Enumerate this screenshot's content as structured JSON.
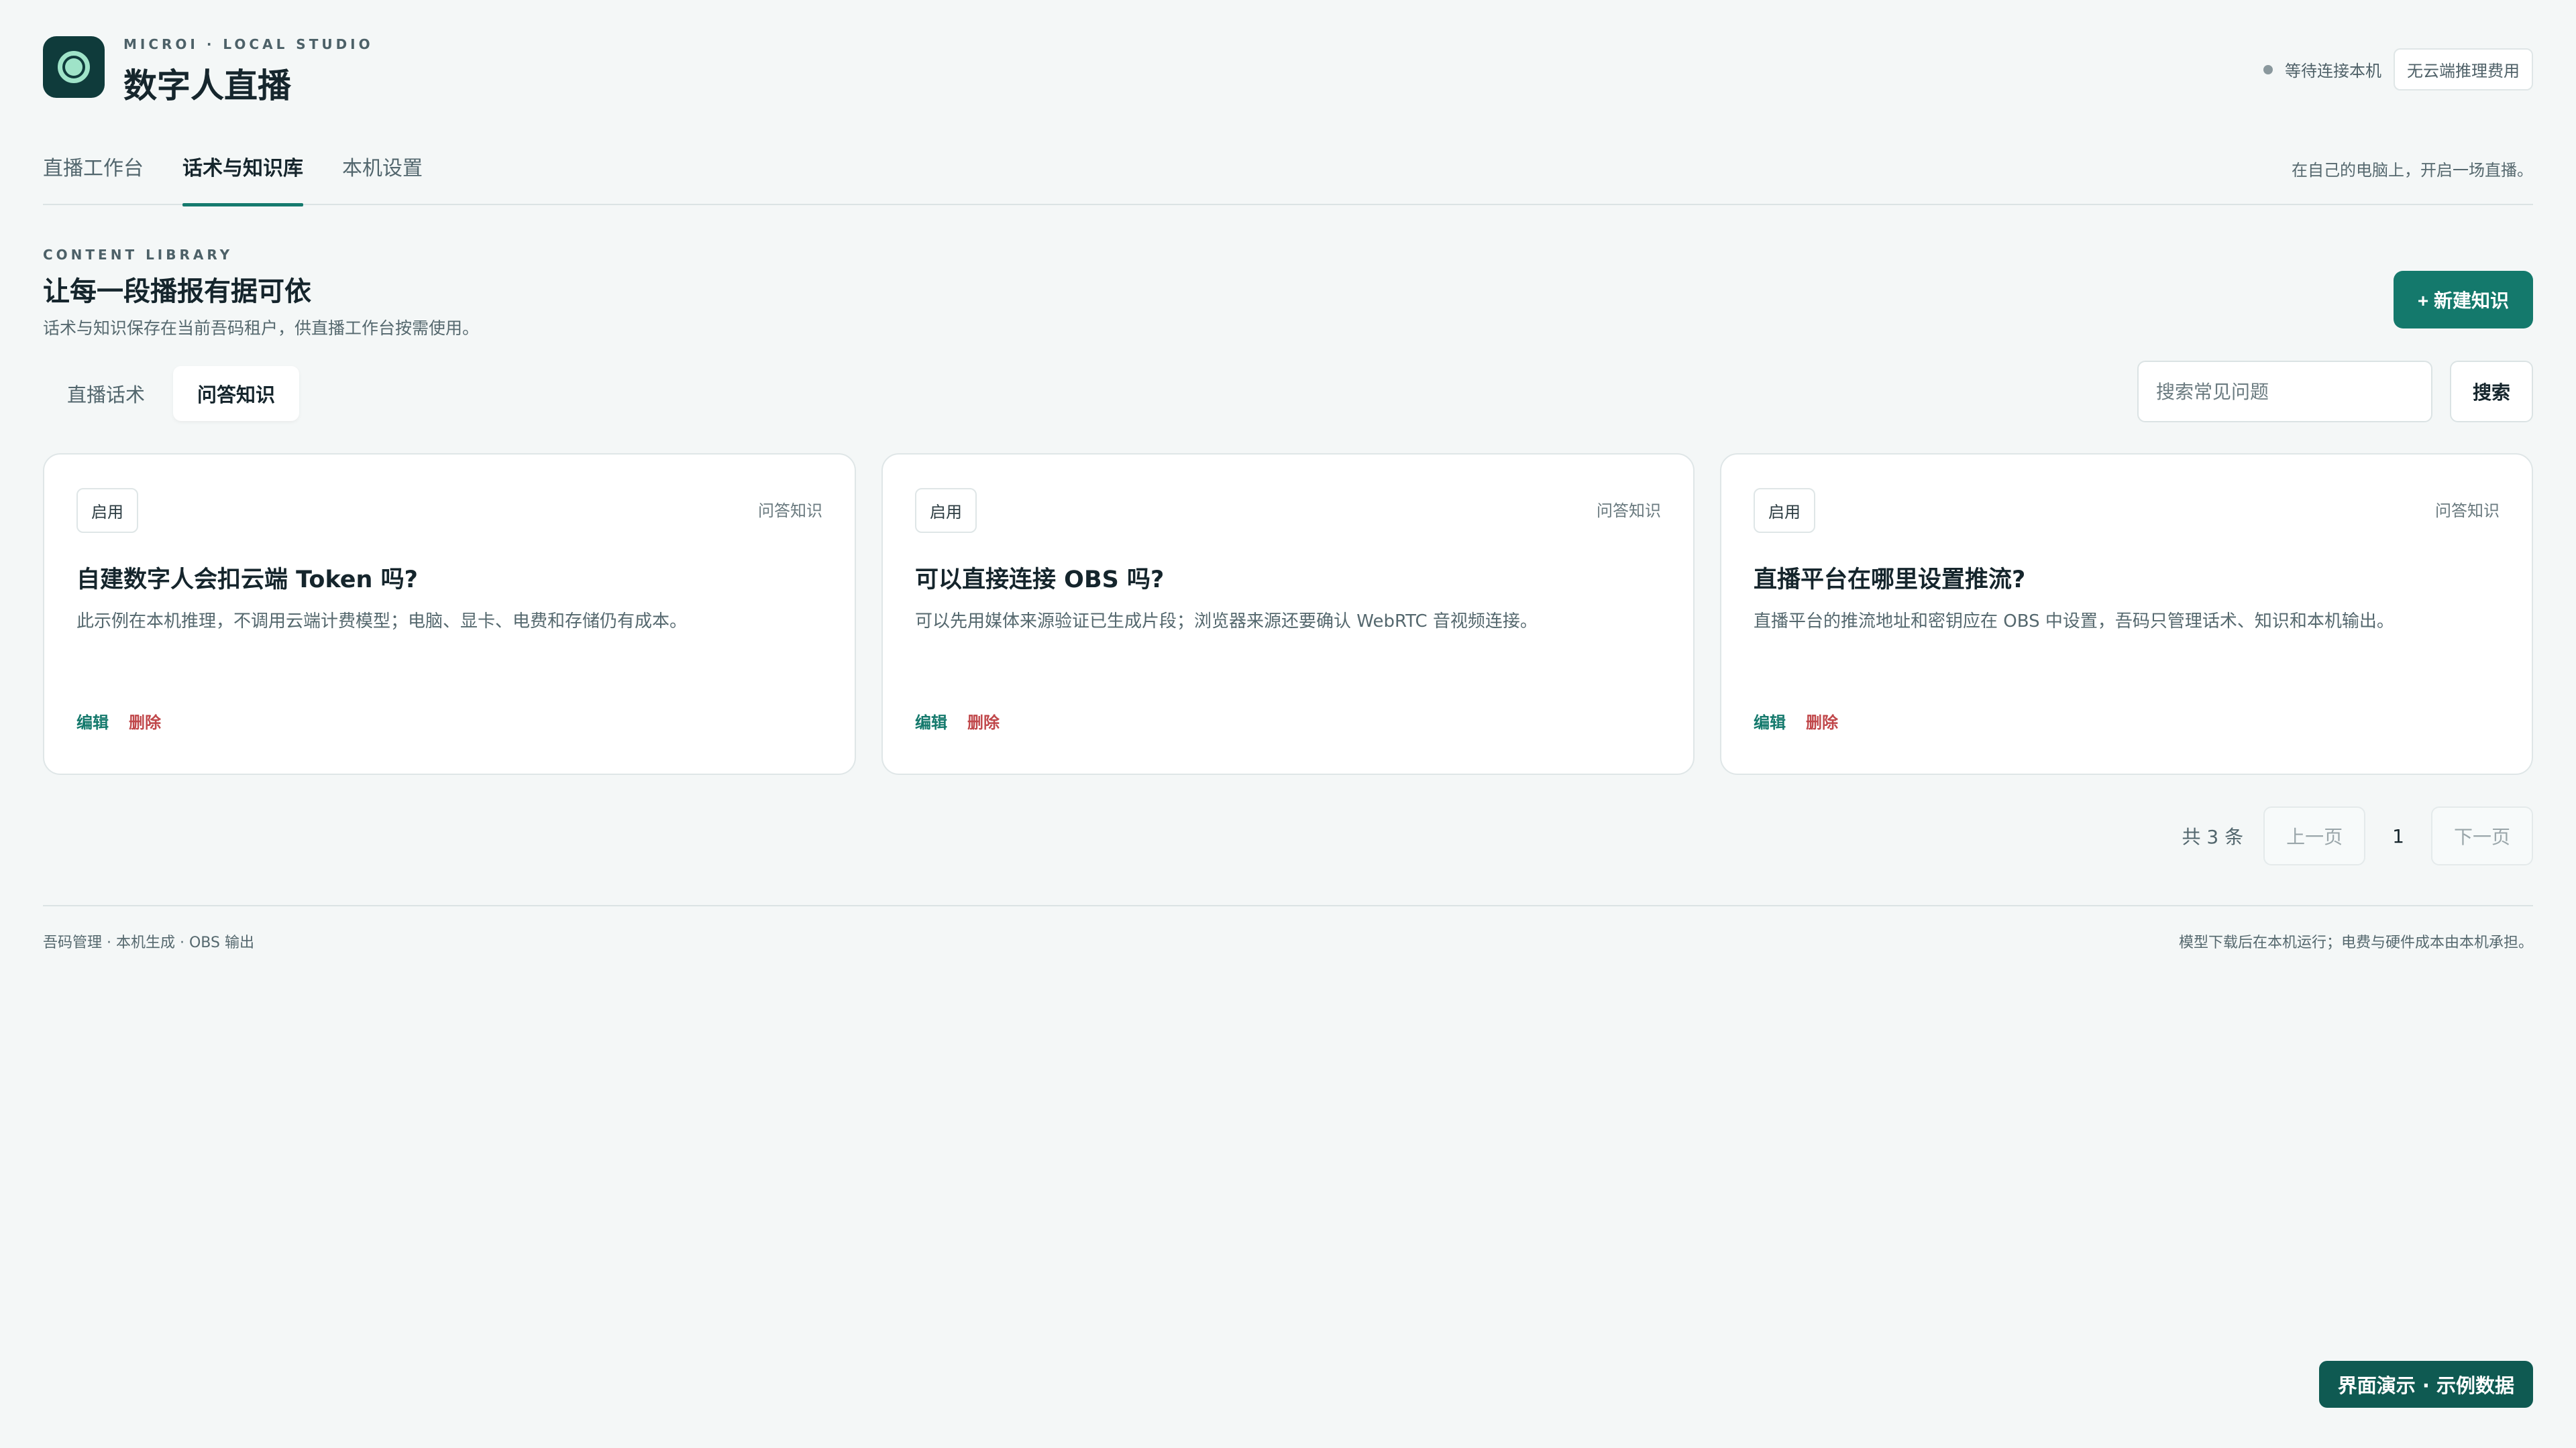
{
  "brand": {
    "small": "MICROI · LOCAL STUDIO",
    "title": "数字人直播"
  },
  "header": {
    "status_text": "等待连接本机",
    "badge": "无云端推理费用"
  },
  "nav": {
    "tabs": [
      {
        "label": "直播工作台"
      },
      {
        "label": "话术与知识库"
      },
      {
        "label": "本机设置"
      }
    ],
    "active_index": 1,
    "tagline": "在自己的电脑上，开启一场直播。"
  },
  "section": {
    "eyebrow": "CONTENT LIBRARY",
    "title": "让每一段播报有据可依",
    "desc": "话术与知识保存在当前吾码租户，供直播工作台按需使用。",
    "new_button": "+ 新建知识"
  },
  "subtabs": [
    {
      "label": "直播话术"
    },
    {
      "label": "问答知识"
    }
  ],
  "search": {
    "placeholder": "搜索常见问题",
    "button": "搜索"
  },
  "cards": [
    {
      "status": "启用",
      "type": "问答知识",
      "title": "自建数字人会扣云端 Token 吗?",
      "desc": "此示例在本机推理，不调用云端计费模型；电脑、显卡、电费和存储仍有成本。",
      "edit": "编辑",
      "delete": "删除"
    },
    {
      "status": "启用",
      "type": "问答知识",
      "title": "可以直接连接 OBS 吗?",
      "desc": "可以先用媒体来源验证已生成片段；浏览器来源还要确认 WebRTC 音视频连接。",
      "edit": "编辑",
      "delete": "删除"
    },
    {
      "status": "启用",
      "type": "问答知识",
      "title": "直播平台在哪里设置推流?",
      "desc": "直播平台的推流地址和密钥应在 OBS 中设置，吾码只管理话术、知识和本机输出。",
      "edit": "编辑",
      "delete": "删除"
    }
  ],
  "pagination": {
    "total": "共 3 条",
    "prev": "上一页",
    "page": "1",
    "next": "下一页"
  },
  "footer": {
    "left": "吾码管理 · 本机生成 · OBS 输出",
    "right": "模型下载后在本机运行；电费与硬件成本由本机承担。"
  },
  "demo_badge": "界面演示 · 示例数据",
  "colors": {
    "accent": "#14796c",
    "danger": "#c0474a",
    "logo_bg": "#0f3b3b",
    "background": "#f4f7f7"
  }
}
